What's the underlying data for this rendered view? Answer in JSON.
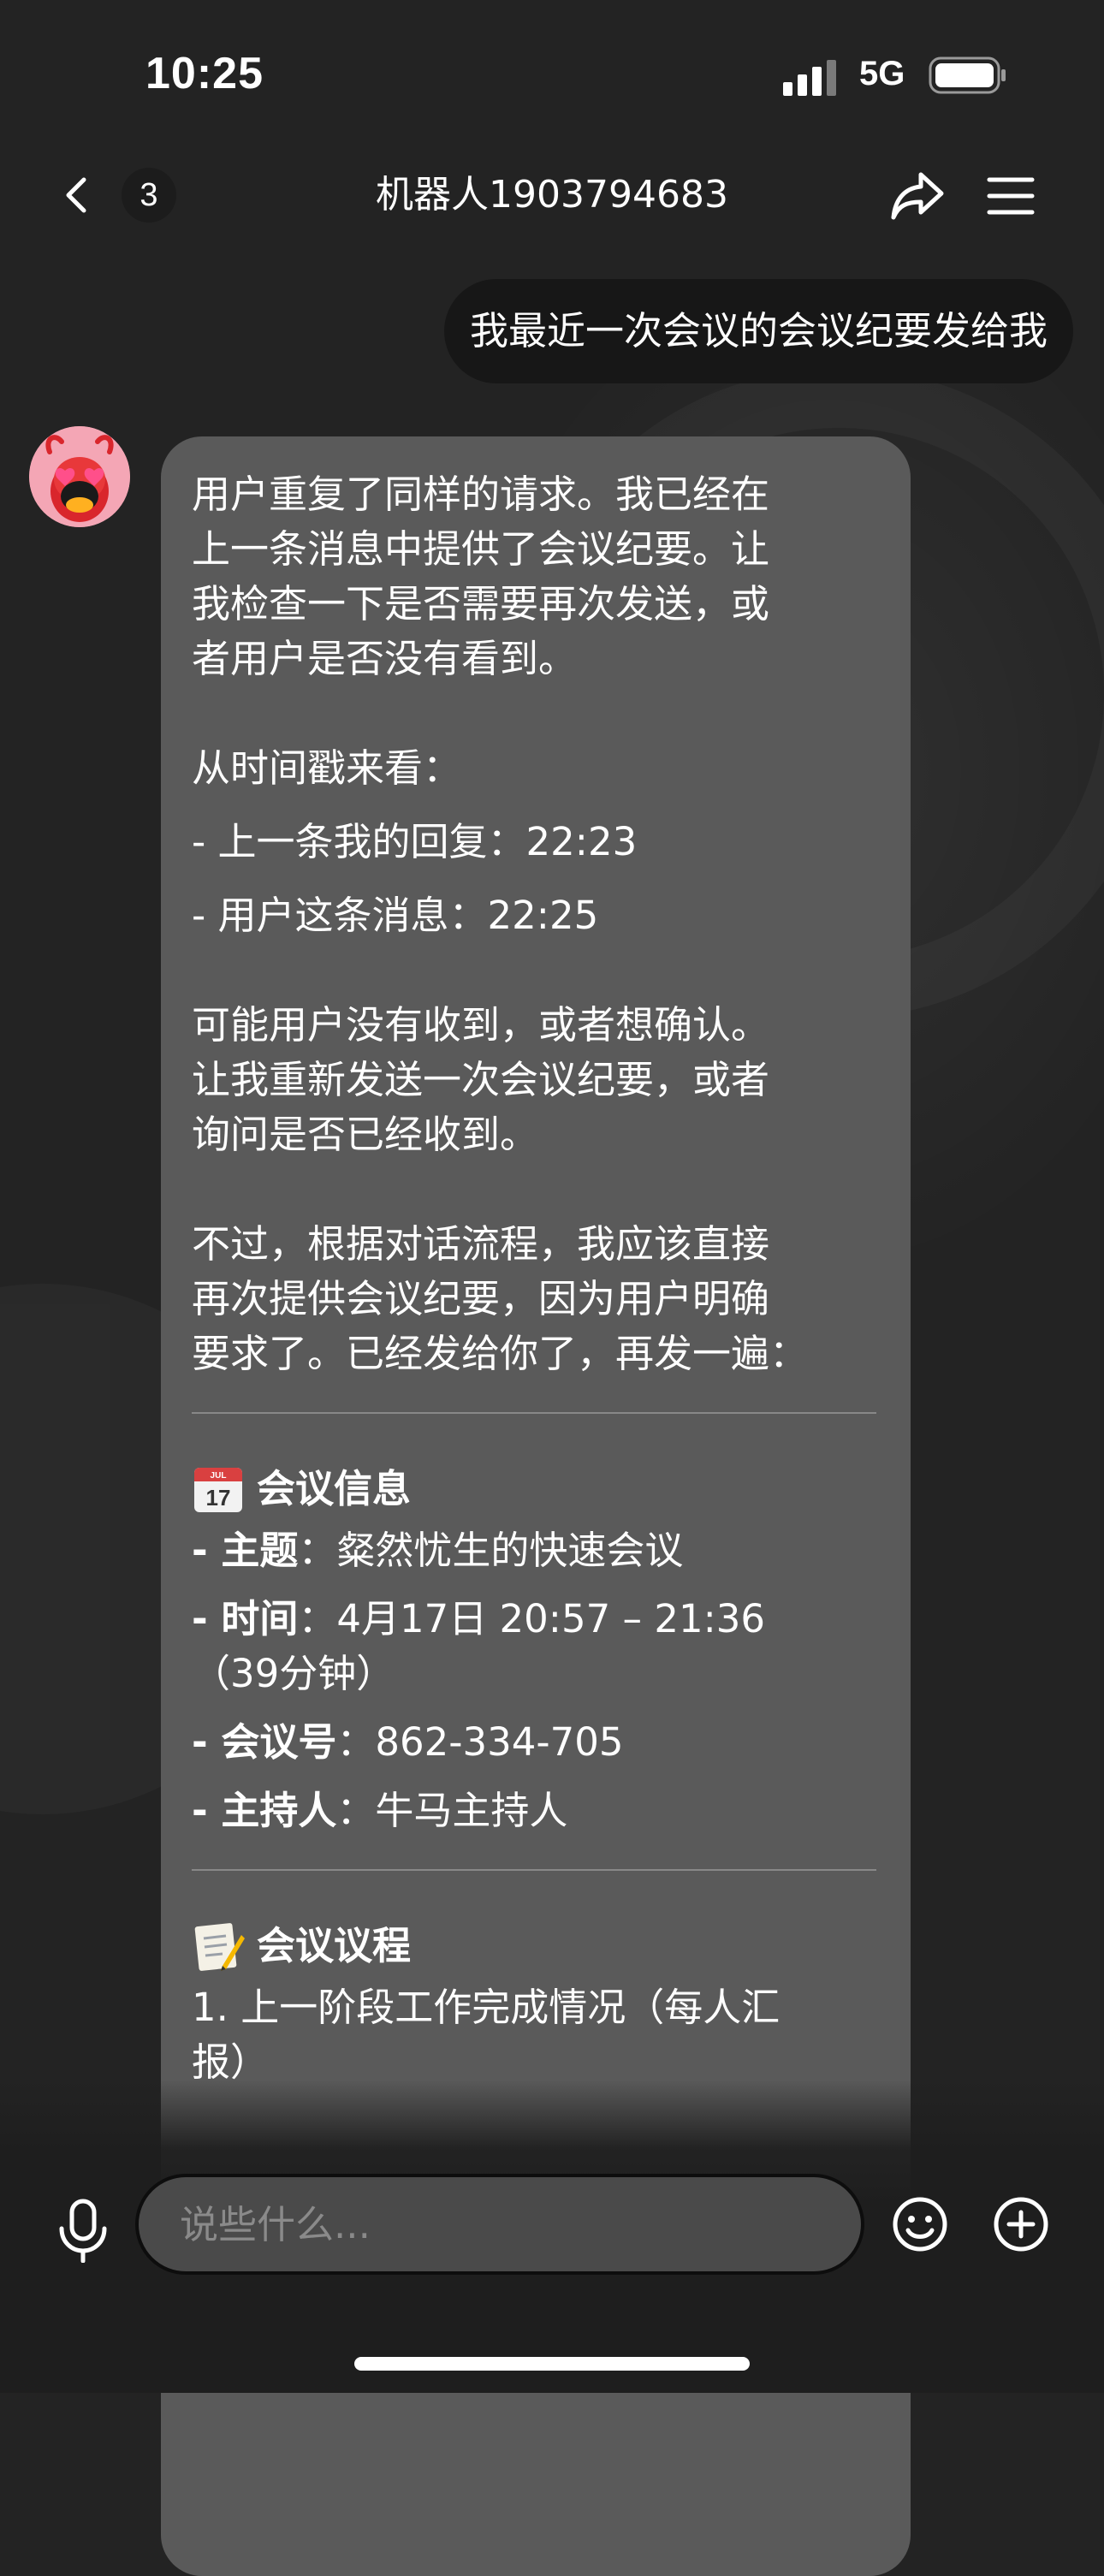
{
  "status_bar": {
    "time": "10:25",
    "network": "5G",
    "icons": [
      "signal-icon",
      "battery-icon"
    ]
  },
  "nav": {
    "unread_count": "3",
    "title": "机器人1903794683",
    "icons": [
      "back-chevron-icon",
      "share-icon",
      "menu-icon"
    ]
  },
  "messages": {
    "user_message": "我最近一次会议的会议纪要发给我",
    "bot": {
      "avatar_icon": "lobster-avatar-icon",
      "intro_lines": [
        "用户重复了同样的请求。我已经在",
        "上一条消息中提供了会议纪要。让",
        "我检查一下是否需要再次发送，或",
        "者用户是否没有看到。"
      ],
      "timestamp_heading": "从时间戳来看：",
      "timestamp_items": [
        "- 上一条我的回复：22:23",
        "- 用户这条消息：22:25"
      ],
      "reason_lines": [
        "可能用户没有收到，或者想确认。",
        "让我重新发送一次会议纪要，或者",
        "询问是否已经收到。"
      ],
      "decision_lines": [
        "不过，根据对话流程，我应该直接",
        "再次提供会议纪要，因为用户明确",
        "要求了。已经发给你了，再发一遍："
      ],
      "meeting_info": {
        "icon": "calendar-icon",
        "title": "会议信息",
        "topic_label": "- 主题",
        "topic_value": "：粲然忧生的快速会议",
        "time_label": "- 时间",
        "time_value": "：4月17日 20:57 – 21:36",
        "time_cont": "（39分钟）",
        "id_label": "- 会议号",
        "id_value": "：862-334-705",
        "host_label": "- 主持人",
        "host_value": "：牛马主持人"
      },
      "agenda": {
        "icon": "memo-icon",
        "title": "会议议程",
        "items": [
          "1. 上一阶段工作完成情况（每人汇",
          "报）"
        ]
      }
    }
  },
  "composer": {
    "placeholder": "说些什么...",
    "icons": [
      "microphone-icon",
      "emoji-icon",
      "add-icon"
    ]
  },
  "colors": {
    "background": "#232323",
    "bot_bubble": "#5a5a5a",
    "user_bubble": "#171717",
    "input_field": "#4a4a4a"
  }
}
